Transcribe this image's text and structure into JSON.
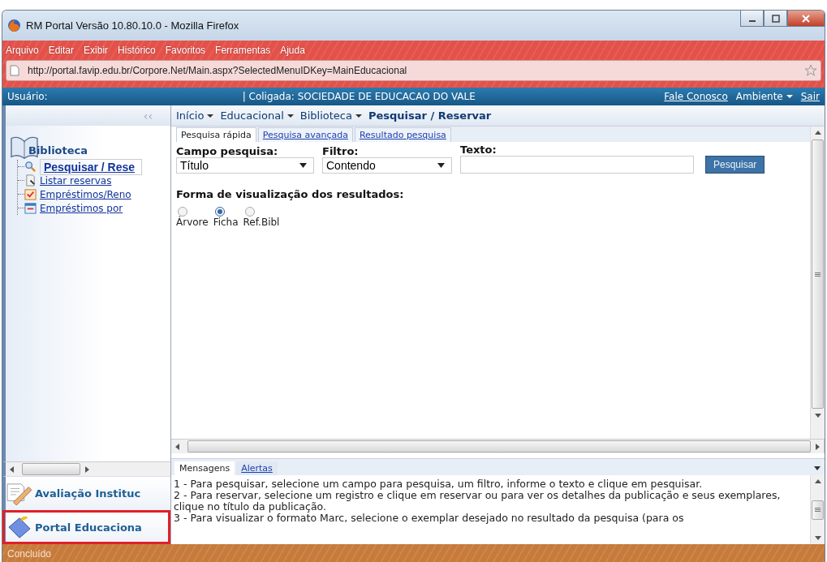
{
  "window": {
    "title": "RM Portal Versão 10.80.10.0 - Mozilla Firefox"
  },
  "menu": [
    {
      "label": "Arquivo"
    },
    {
      "label": "Editar"
    },
    {
      "label": "Exibir"
    },
    {
      "label": "Histórico"
    },
    {
      "label": "Favoritos"
    },
    {
      "label": "Ferramentas"
    },
    {
      "label": "Ajuda"
    }
  ],
  "address_bar": {
    "value": "http://portal.favip.edu.br/Corpore.Net/Main.aspx?SelectedMenuIDKey=MainEducacional"
  },
  "top_bar": {
    "user_label": "Usuário:",
    "coligada": "| Coligada: SOCIEDADE DE EDUCACAO DO VALE",
    "links": [
      {
        "label": "Fale Conosco",
        "kind": "link"
      },
      {
        "label": "Ambiente",
        "kind": "dropdown"
      },
      {
        "label": "Sair",
        "kind": "link"
      }
    ]
  },
  "sidebar": {
    "collapse": "‹‹",
    "section_title": "Biblioteca",
    "items": [
      {
        "label": "Pesquisar / Rese",
        "selected": true,
        "kind": "search"
      },
      {
        "label": "Listar reservas",
        "selected": false,
        "kind": "list"
      },
      {
        "label": "Empréstimos/Reno",
        "selected": false,
        "kind": "check"
      },
      {
        "label": "Empréstimos por",
        "selected": false,
        "kind": "calendar"
      }
    ],
    "modules": [
      {
        "label": "Avaliação Instituc",
        "kind": "pencil",
        "highlighted": false
      },
      {
        "label": "Portal Educaciona",
        "kind": "ruler",
        "highlighted": true
      }
    ]
  },
  "breadcrumb": [
    {
      "label": "Início",
      "dropdown": true
    },
    {
      "label": "Educacional",
      "dropdown": true
    },
    {
      "label": "Biblioteca",
      "dropdown": true
    },
    {
      "label": "Pesquisar / Reservar",
      "dropdown": false
    }
  ],
  "tabs": [
    {
      "label": "Pesquisa rápida",
      "selected": true
    },
    {
      "label": "Pesquisa avançada",
      "selected": false
    },
    {
      "label": "Resultado pesquisa",
      "selected": false
    }
  ],
  "search_form": {
    "field_label": "Campo pesquisa:",
    "field_value": "Título",
    "filter_label": "Filtro:",
    "filter_value": "Contendo",
    "text_label": "Texto:",
    "button": "Pesquisar"
  },
  "view_mode": {
    "label": "Forma de visualização dos resultados:",
    "options": [
      {
        "label": "Árvore",
        "selected": false
      },
      {
        "label": "Ficha",
        "selected": true
      },
      {
        "label": "Ref.Bibl",
        "selected": false
      }
    ]
  },
  "messages": {
    "tabs": [
      {
        "label": "Mensagens",
        "selected": true
      },
      {
        "label": "Alertas",
        "selected": false
      }
    ],
    "lines": [
      "1 - Para pesquisar, selecione um campo para pesquisa, um filtro, informe o texto e clique em pesquisar.",
      "2 - Para reservar, selecione um registro e clique em reservar ou para ver os detalhes da publicação e seus exemplares, clique no título da publicação.",
      "3 - Para visualizar o formato Marc, selecione o exemplar desejado no resultado da pesquisa (para os"
    ]
  },
  "status_bar": {
    "text": "Concluído"
  }
}
